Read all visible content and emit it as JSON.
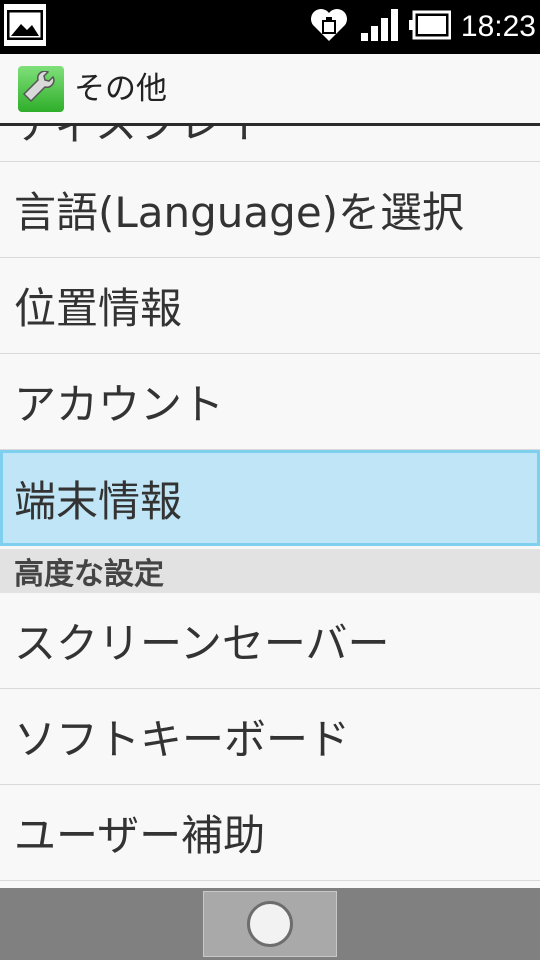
{
  "status_bar": {
    "time": "18:23",
    "icons": [
      "image-icon",
      "heart-battery-icon",
      "signal-icon",
      "battery-icon"
    ]
  },
  "header": {
    "title": "その他",
    "icon": "wrench-icon"
  },
  "list": {
    "partial_item": "ディスプレイ",
    "items": [
      {
        "label": "言語(Language)を選択"
      },
      {
        "label": "位置情報"
      },
      {
        "label": "アカウント"
      },
      {
        "label": "端末情報",
        "selected": true
      }
    ],
    "section_header": "高度な設定",
    "advanced_items": [
      {
        "label": "スクリーンセーバー"
      },
      {
        "label": "ソフトキーボード"
      },
      {
        "label": "ユーザー補助"
      }
    ]
  },
  "nav_bar": {
    "home": "home-button"
  },
  "colors": {
    "selected_bg": "#bfe5f6",
    "selected_border": "#7fd0ee",
    "section_bg": "#e2e2e2",
    "nav_bg": "#808080"
  }
}
